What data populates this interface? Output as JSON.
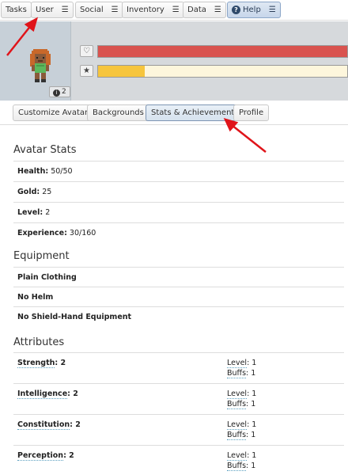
{
  "nav": {
    "items": [
      {
        "label": "Tasks",
        "menu": false
      },
      {
        "label": "User",
        "menu": true
      },
      {
        "label": "Social",
        "menu": true
      },
      {
        "label": "Inventory",
        "menu": true
      },
      {
        "label": "Data",
        "menu": true
      },
      {
        "label": "Help",
        "menu": true
      }
    ],
    "menu_glyph": "☰",
    "help_glyph": "?"
  },
  "header": {
    "level_badge": "2",
    "level_badge_icon": "i",
    "health_icon": "♡",
    "experience_icon": "★",
    "health_fraction": 1.0,
    "experience_fraction": 0.1875,
    "colors": {
      "health": "#d9534f",
      "experience": "#f6c53d"
    }
  },
  "tabs": [
    "Customize Avatar",
    "Backgrounds",
    "Stats & Achievements",
    "Profile"
  ],
  "active_tab": "Stats & Achievements",
  "avatar_stats": {
    "title": "Avatar Stats",
    "rows": [
      {
        "label": "Health:",
        "value": " 50/50"
      },
      {
        "label": "Gold:",
        "value": " 25"
      },
      {
        "label": "Level:",
        "value": " 2"
      },
      {
        "label": "Experience:",
        "value": " 30/160"
      }
    ]
  },
  "equipment": {
    "title": "Equipment",
    "rows": [
      "Plain Clothing",
      "No Helm",
      "No Shield-Hand Equipment"
    ]
  },
  "attributes": {
    "title": "Attributes",
    "level_label": "Level",
    "buffs_label": "Buffs",
    "rows": [
      {
        "name": "Strength",
        "points": ": 2",
        "level": ": 1",
        "buffs": ": 1"
      },
      {
        "name": "Intelligence",
        "points": ": 2",
        "level": ": 1",
        "buffs": ": 1"
      },
      {
        "name": "Constitution",
        "points": ": 2",
        "level": ": 1",
        "buffs": ": 1"
      },
      {
        "name": "Perception",
        "points": ": 2",
        "level": ": 1",
        "buffs": ": 1"
      }
    ]
  }
}
